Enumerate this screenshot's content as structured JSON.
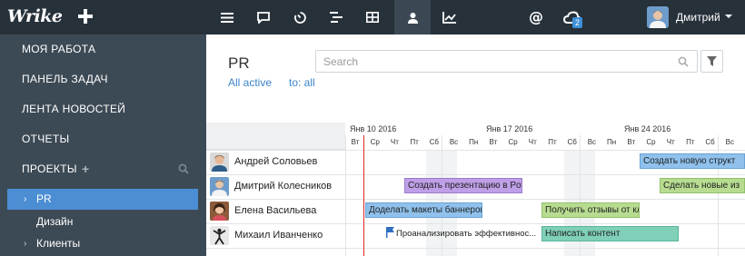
{
  "topbar": {
    "logo": "Wrike",
    "badge_count": "2",
    "user_name": "Дмитрий"
  },
  "sidebar": {
    "items": [
      {
        "label": "Моя работа"
      },
      {
        "label": "Панель задач"
      },
      {
        "label": "Лента новостей"
      },
      {
        "label": "Отчеты"
      },
      {
        "label": "Проекты"
      }
    ],
    "subitems": [
      {
        "label": "PR"
      },
      {
        "label": "Дизайн"
      },
      {
        "label": "Клиенты"
      }
    ]
  },
  "main": {
    "title": "PR",
    "filter_status": "All active",
    "filter_to": "to: all",
    "search_placeholder": "Search"
  },
  "gantt": {
    "weeks": [
      {
        "label": "Янв 10 2016"
      },
      {
        "label": "Янв 17 2016"
      },
      {
        "label": "Янв 24 2016"
      }
    ],
    "days": [
      "Вт",
      "Ср",
      "Чт",
      "Пт",
      "Сб",
      "Вс",
      "Пн",
      "Вт",
      "Ср",
      "Чт",
      "Пт",
      "Сб",
      "Вс",
      "Пн",
      "Вт",
      "Ср",
      "Чт",
      "Пт",
      "Сб",
      "Вс"
    ],
    "people": [
      {
        "name": "Андрей Соловьев"
      },
      {
        "name": "Дмитрий Колесников"
      },
      {
        "name": "Елена Васильева"
      },
      {
        "name": "Михаил Иванченко"
      }
    ],
    "tasks": [
      {
        "label": "Создать новую структ",
        "color": "#8fc1ec"
      },
      {
        "label": "Создать презентацию в Powerpoint",
        "color": "#bf9fe8"
      },
      {
        "label": "Сделать новые из",
        "color": "#b7dc90"
      },
      {
        "label": "Доделать макеты баннеров",
        "color": "#8fc1ec"
      },
      {
        "label": "Получить отзывы от клиентов",
        "color": "#b7dc90"
      },
      {
        "label": "Проанализировать эффективнос...",
        "color": "#ffffff"
      },
      {
        "label": "Написать контент",
        "color": "#7fcfb9"
      }
    ]
  }
}
